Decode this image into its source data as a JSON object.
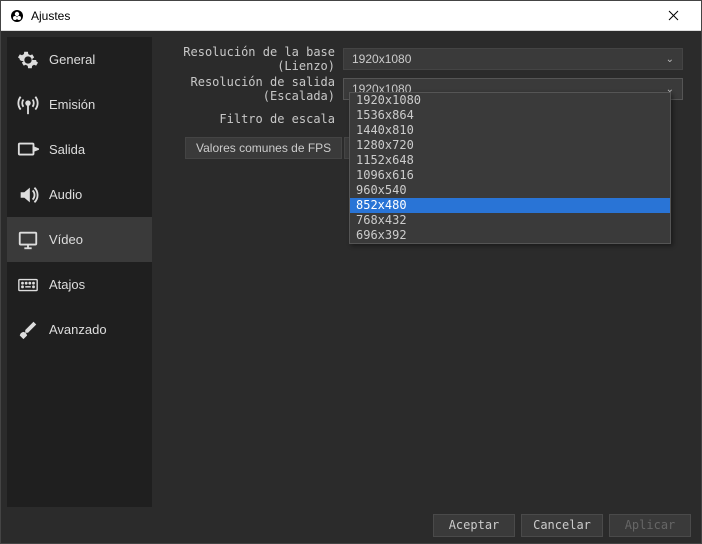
{
  "window": {
    "title": "Ajustes"
  },
  "sidebar": {
    "items": [
      {
        "label": "General"
      },
      {
        "label": "Emisión"
      },
      {
        "label": "Salida"
      },
      {
        "label": "Audio"
      },
      {
        "label": "Vídeo"
      },
      {
        "label": "Atajos"
      },
      {
        "label": "Avanzado"
      }
    ],
    "active_index": 4
  },
  "form": {
    "base_resolution_label": "Resolución de la base (Lienzo)",
    "base_resolution_value": "1920x1080",
    "output_resolution_label": "Resolución de salida (Escalada)",
    "output_resolution_value": "1920x1080",
    "scale_filter_label": "Filtro de escala",
    "fps_label": "Valores comunes de FPS"
  },
  "dropdown": {
    "options": [
      "1920x1080",
      "1536x864",
      "1440x810",
      "1280x720",
      "1152x648",
      "1096x616",
      "960x540",
      "852x480",
      "768x432",
      "696x392"
    ],
    "highlight_index": 7
  },
  "footer": {
    "accept": "Aceptar",
    "cancel": "Cancelar",
    "apply": "Aplicar"
  },
  "icons": {
    "gear": "gear-icon",
    "broadcast": "broadcast-icon",
    "output": "output-icon",
    "audio": "audio-icon",
    "video": "video-icon",
    "keyboard": "keyboard-icon",
    "tools": "tools-icon"
  }
}
